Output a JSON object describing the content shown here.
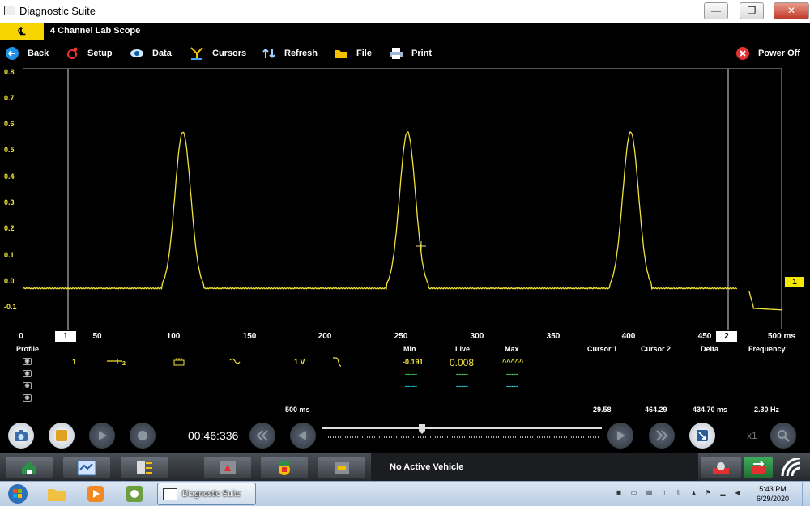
{
  "window": {
    "title": "Diagnostic Suite",
    "min": "—",
    "max": "❐",
    "close": "✕"
  },
  "app": {
    "logo": "℄",
    "name": "4 Channel Lab Scope"
  },
  "toolbar": {
    "back": "Back",
    "setup": "Setup",
    "data": "Data",
    "cursors": "Cursors",
    "refresh": "Refresh",
    "file": "File",
    "print": "Print",
    "power_off": "Power Off"
  },
  "plot": {
    "y_ticks": [
      "0.8",
      "0.7",
      "0.6",
      "0.5",
      "0.4",
      "0.3",
      "0.2",
      "0.1",
      "0.0",
      "-0.1"
    ],
    "x_ticks": [
      "0",
      "50",
      "100",
      "150",
      "200",
      "250",
      "300",
      "350",
      "400",
      "450"
    ],
    "x_unit": "500 ms",
    "cursor1_label": "1",
    "cursor2_label": "2",
    "channel_marker": "1",
    "trace_color": "#f2e33a"
  },
  "info": {
    "headers": {
      "profile": "Profile",
      "min": "Min",
      "live": "Live",
      "max": "Max",
      "cursor1": "Cursor 1",
      "cursor2": "Cursor 2",
      "delta": "Delta",
      "frequency": "Frequency"
    },
    "channel": {
      "number": "1",
      "scale": "1 V",
      "min": "-0.191",
      "live": "0.008",
      "max": "^^^^^"
    },
    "dash": "-----",
    "sweep": "500 ms",
    "cursor1": "29.58",
    "cursor2": "464.29",
    "delta": "434.70 ms",
    "frequency": "2.30 Hz"
  },
  "controls": {
    "timer": "00:46:336",
    "zoom": "x1"
  },
  "status": {
    "vehicle": "No Active Vehicle"
  },
  "taskbar": {
    "active_task": "Diagnostic Suite",
    "time": "5:43 PM",
    "date": "6/29/2020"
  }
}
